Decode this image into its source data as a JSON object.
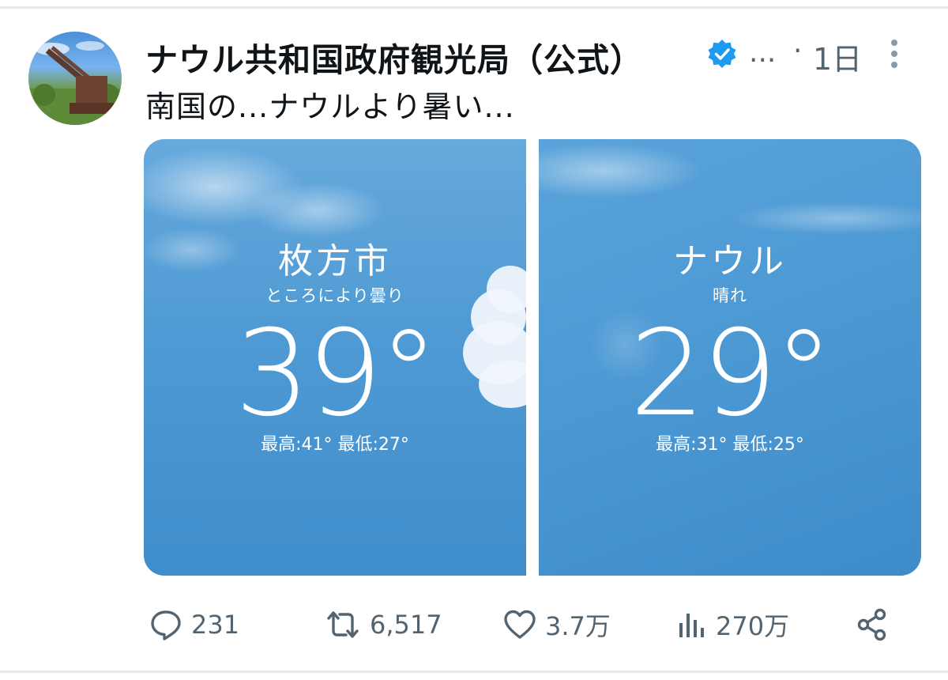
{
  "post": {
    "display_name": "ナウル共和国政府観光局（公式）",
    "handle": "...",
    "separator": "·",
    "time": "1日",
    "text": "南国の...ナウルより暑い...",
    "verified_color": "#1d9bf0"
  },
  "media": {
    "left": {
      "city": "枚方市",
      "condition": "ところにより曇り",
      "temperature": "39°",
      "hilo": "最高:41° 最低:27°"
    },
    "right": {
      "city": "ナウル",
      "condition": "晴れ",
      "temperature": "29°",
      "hilo": "最高:31° 最低:25°"
    }
  },
  "actions": {
    "replies": "231",
    "reposts": "6,517",
    "likes": "3.7万",
    "views": "270万"
  },
  "icons": [
    "verified-badge-icon",
    "more-icon",
    "reply-icon",
    "repost-icon",
    "like-icon",
    "views-icon",
    "share-icon"
  ]
}
